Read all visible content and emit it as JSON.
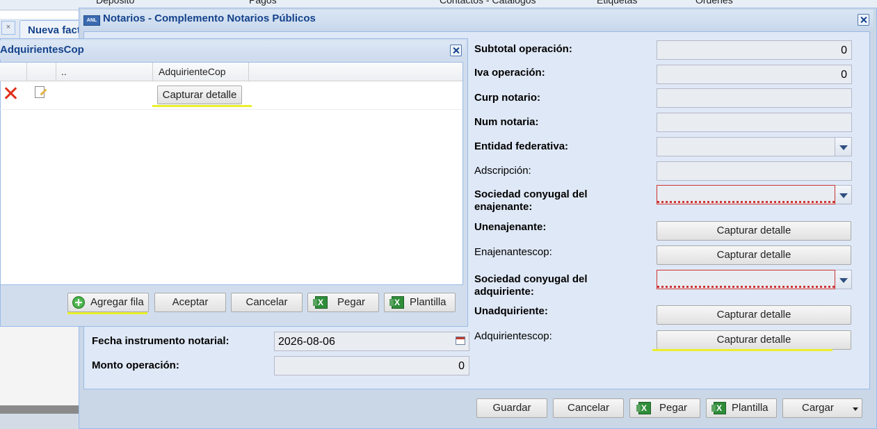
{
  "background": {
    "toolbar_items": [
      "Depósito",
      "Pagos",
      "Contactos - Catálogos",
      "Etiquetas",
      "Órdenes"
    ],
    "tab_label": "Nueva factura"
  },
  "dialog": {
    "title": "Notarios - Complemento Notarios Públicos",
    "fields_left": [
      {
        "label": "Fecha instrumento notarial:",
        "value": "2026-08-06"
      },
      {
        "label": "Monto operación:",
        "value": "0"
      }
    ],
    "fields_right": [
      {
        "label": "Subtotal operación:",
        "value": "0"
      },
      {
        "label": "Iva operación:",
        "value": "0"
      },
      {
        "label": "Curp notario:",
        "value": ""
      },
      {
        "label": "Num notaria:",
        "value": ""
      },
      {
        "label": "Entidad federativa:",
        "value": ""
      },
      {
        "label": "Adscripción:",
        "value": ""
      },
      {
        "label": "Sociedad conyugal del enajenante:",
        "value": ""
      },
      {
        "label": "Unenajenante:",
        "button": "Capturar detalle"
      },
      {
        "label": "Enajenantescop:",
        "button": "Capturar detalle"
      },
      {
        "label": "Sociedad conyugal del adquiriente:",
        "value": ""
      },
      {
        "label": "Unadquiriente:",
        "button": "Capturar detalle"
      },
      {
        "label": "Adquirientescop:",
        "button": "Capturar detalle"
      }
    ],
    "footer_buttons": {
      "guardar": "Guardar",
      "cancelar": "Cancelar",
      "pegar": "Pegar",
      "plantilla": "Plantilla",
      "cargar": "Cargar"
    },
    "accent_color": "#15428b"
  },
  "popup": {
    "title": "AdquirientesCop",
    "grid_headers": [
      "..",
      "AdquirienteCop"
    ],
    "rows": [
      {
        "button": "Capturar detalle"
      }
    ],
    "buttons": {
      "agregar": "Agregar fila",
      "aceptar": "Aceptar",
      "cancelar": "Cancelar",
      "pegar": "Pegar",
      "plantilla": "Plantilla"
    }
  }
}
